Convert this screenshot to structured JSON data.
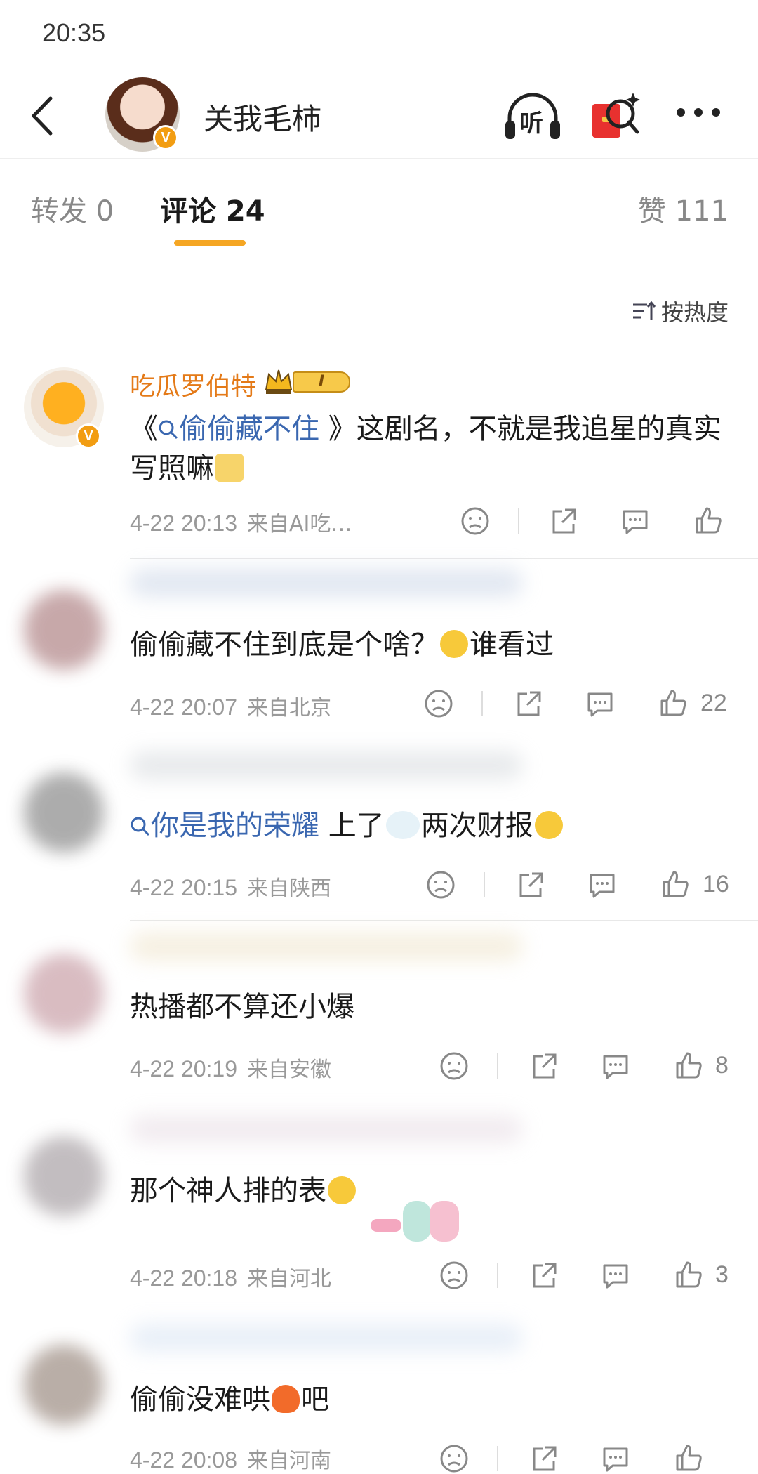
{
  "status_bar": {
    "time": "20:35"
  },
  "header": {
    "title": "关我毛柿",
    "listen_label": "听",
    "verified_mark": "V"
  },
  "tabs": {
    "repost": "转发 0",
    "comments": "评论 24",
    "likes": "赞 111"
  },
  "sort": {
    "label": "按热度"
  },
  "comments": [
    {
      "name": "吃瓜罗伯特",
      "level_badge": "I",
      "text_prefix": "《",
      "topic": "偷偷藏不住",
      "text_suffix": " 》这剧名，不就是我追星的真实写照嘛",
      "time": "4-22 20:13",
      "source": "来自AI吃…",
      "likes": ""
    },
    {
      "text": "偷偷藏不住到底是个啥？",
      "text_tail": "谁看过",
      "time": "4-22 20:07",
      "source": "来自北京",
      "likes": "22"
    },
    {
      "topic": "你是我的荣耀",
      "text_mid": " 上了",
      "text_tail": "两次财报",
      "time": "4-22 20:15",
      "source": "来自陕西",
      "likes": "16"
    },
    {
      "text": "热播都不算还小爆",
      "time": "4-22 20:19",
      "source": "来自安徽",
      "likes": "8"
    },
    {
      "text": "那个神人排的表",
      "time": "4-22 20:18",
      "source": "来自河北",
      "likes": "3"
    },
    {
      "text": "偷偷没难哄",
      "text_tail": "吧",
      "time": "4-22 20:08",
      "source": "来自河南",
      "likes": ""
    }
  ]
}
